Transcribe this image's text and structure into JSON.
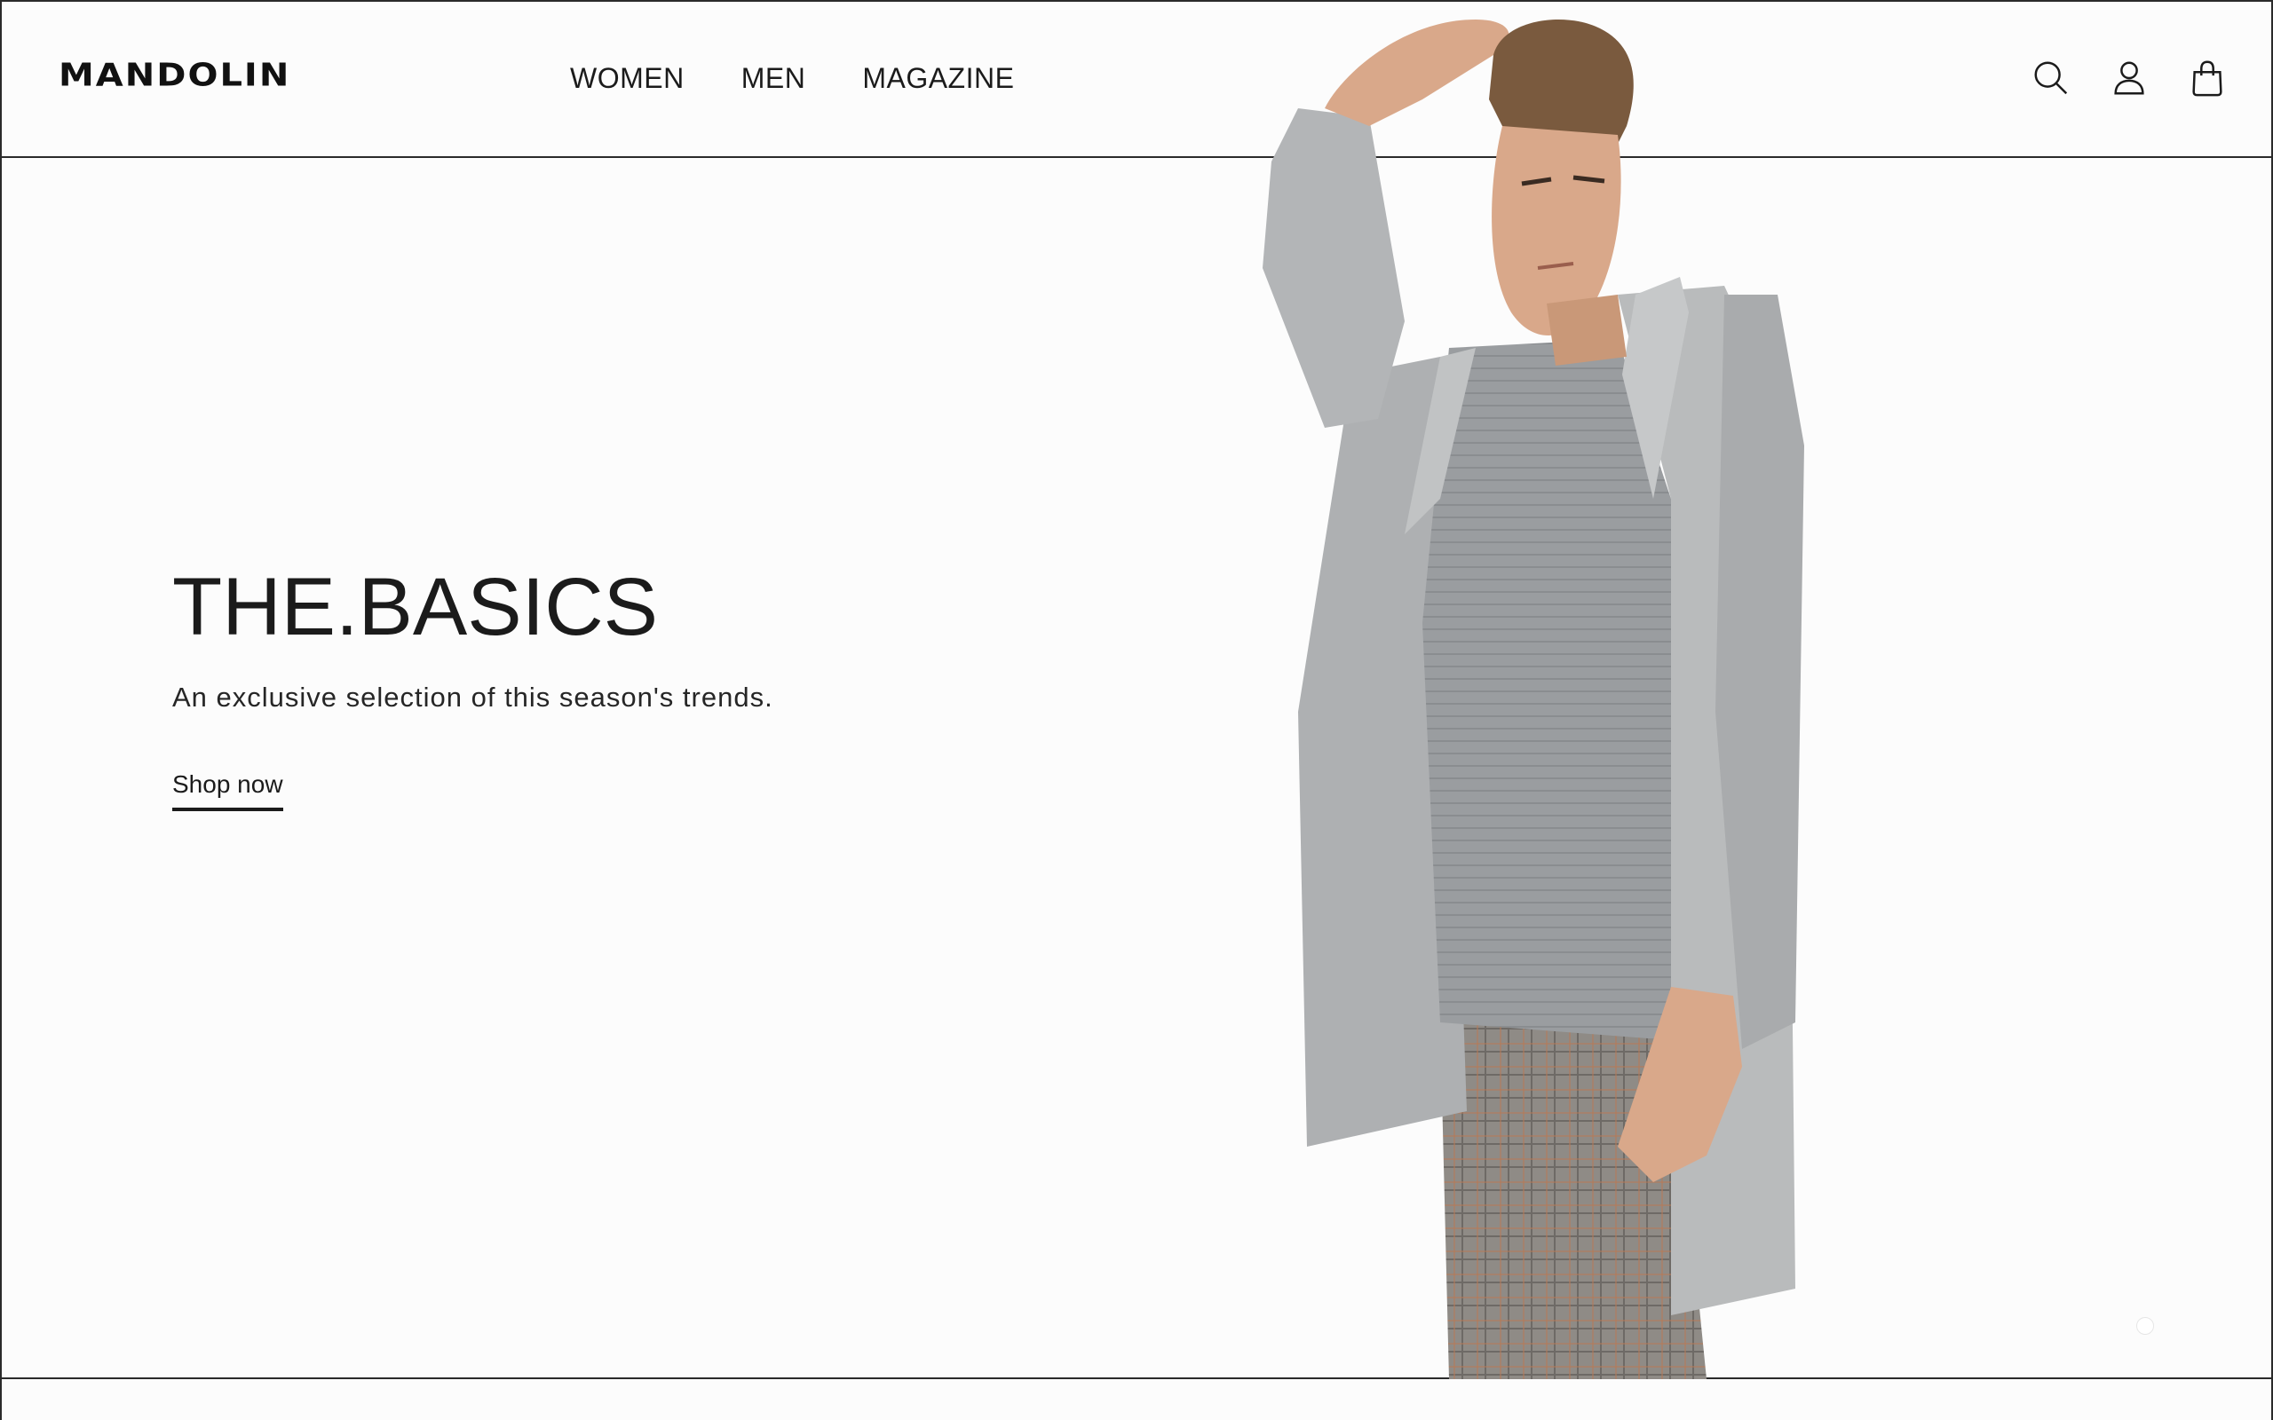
{
  "brand": {
    "logo_text": "MANDOLIN"
  },
  "nav": {
    "items": [
      {
        "label": "WOMEN"
      },
      {
        "label": "MEN"
      },
      {
        "label": "MAGAZINE"
      }
    ]
  },
  "header_icons": [
    "search-icon",
    "account-icon",
    "shopping-bag-icon"
  ],
  "hero": {
    "title": "THE.BASICS",
    "subtitle": "An exclusive selection of this season's trends.",
    "cta_label": "Shop now"
  },
  "colors": {
    "background": "#fcfcfc",
    "text": "#1b1b1b",
    "border": "#2a2a2a",
    "coat": "#b8babb",
    "sweater": "#9a9da0",
    "trousers": "#8d8a86",
    "skin": "#d9a88a",
    "hair": "#7a5a3e"
  }
}
